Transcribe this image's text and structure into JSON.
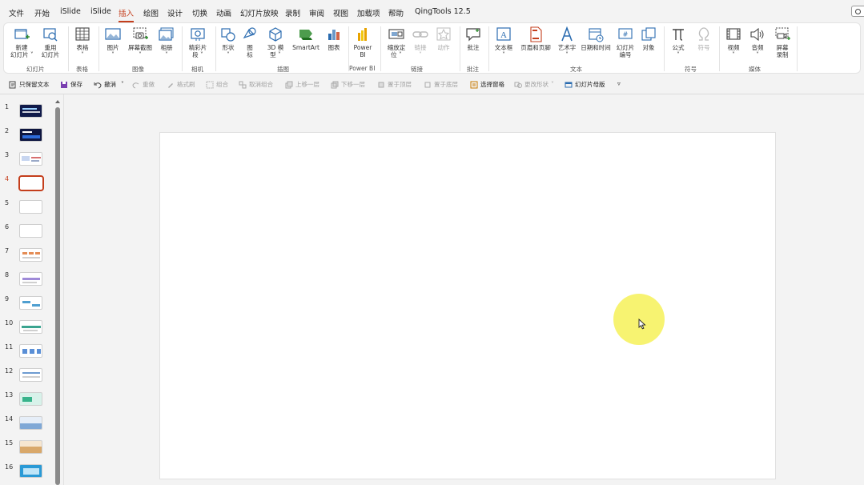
{
  "tabs": [
    "文件",
    "开始",
    "iSlide",
    "iSlide",
    "插入",
    "绘图",
    "设计",
    "切换",
    "动画",
    "幻灯片放映",
    "录制",
    "审阅",
    "视图",
    "加载项",
    "帮助",
    "QingTools 12.5"
  ],
  "active_tab_index": 4,
  "ribbon": {
    "buttons": {
      "new_slide": "新建\n幻灯片 ˅",
      "reuse_slide": "重用\n幻灯片",
      "table": "表格\n˅",
      "picture": "图片\n˅",
      "screenshot": "屏幕截图\n˅",
      "album": "相册\n˅",
      "cameo": "精彩片\n段 ˅",
      "shapes": "形状\n˅",
      "icons": "图\n标",
      "model3d": "3D 模\n型 ˅",
      "smartart": "SmartArt",
      "chart": "图表",
      "powerbi": "Power\nBI",
      "zoom": "缩放定\n位 ˅",
      "link": "链接\n˅",
      "action": "动作",
      "comment": "批注",
      "textbox": "文本框\n˅",
      "header_footer": "页眉和页脚",
      "wordart": "艺术字\n˅",
      "datetime": "日期和时间",
      "slide_number": "幻灯片\n编号",
      "object": "对象",
      "equation": "公式\n˅",
      "symbol": "符号",
      "video": "视频\n˅",
      "audio": "音频\n˅",
      "screen_record": "屏幕\n录制"
    },
    "groups": {
      "slides": "幻灯片",
      "tables": "表格",
      "images": "图像",
      "camera": "相机",
      "illustrations": "插图",
      "powerbi": "Power BI",
      "links": "链接",
      "comments": "批注",
      "text": "文本",
      "symbols": "符号",
      "media": "媒体"
    }
  },
  "qat": {
    "keep_text": "只保留文本",
    "save": "保存",
    "undo": "撤消",
    "redo": "重做",
    "format_painter": "格式刷",
    "group": "组合",
    "ungroup": "取消组合",
    "bring_forward": "上移一层",
    "send_backward": "下移一层",
    "bring_to_front": "置于顶层",
    "send_to_back": "置于底层",
    "selection_pane": "选择窗格",
    "change_shape": "更改形状",
    "slide_master": "幻灯片母版",
    "more": "▿"
  },
  "slides": [
    "1",
    "2",
    "3",
    "4",
    "5",
    "6",
    "7",
    "8",
    "9",
    "10",
    "11",
    "12",
    "13",
    "14",
    "15",
    "16"
  ],
  "active_slide": 4,
  "colors": {
    "accent": "#c43e1c",
    "ribbon_icon_blue": "#2b6cb0",
    "highlight": "#f6f265"
  }
}
